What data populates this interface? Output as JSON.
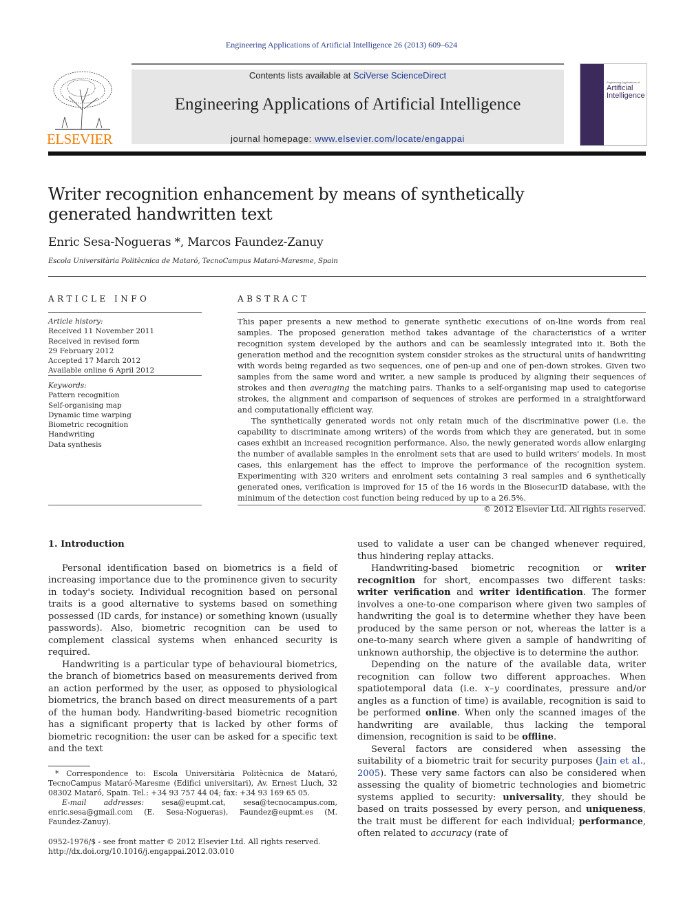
{
  "header": {
    "citation": "Engineering Applications of Artificial Intelligence 26 (2013) 609–624",
    "contents_prefix": "Contents lists available at ",
    "contents_link": "SciVerse ScienceDirect",
    "journal_title": "Engineering Applications of Artificial Intelligence",
    "homepage_prefix": "journal homepage: ",
    "homepage_link": "www.elsevier.com/locate/engappai",
    "publisher_logo": "ELSEVIER",
    "cover_title_line1": "Artificial",
    "cover_title_line2": "Intelligence",
    "cover_kicker": "Engineering Applications of"
  },
  "article": {
    "title": "Writer recognition enhancement by means of synthetically generated handwritten text",
    "authors": "Enric Sesa-Nogueras *, Marcos Faundez-Zanuy",
    "affiliation": "Escola Universitària Politècnica de Mataró, TecnoCampus Mataró-Maresme, Spain"
  },
  "article_info": {
    "heading": "ARTICLE INFO",
    "history_label": "Article history:",
    "history": [
      "Received 11 November 2011",
      "Received in revised form",
      "29 February 2012",
      "Accepted 17 March 2012",
      "Available online 6 April 2012"
    ],
    "keywords_label": "Keywords:",
    "keywords": [
      "Pattern recognition",
      "Self-organising map",
      "Dynamic time warping",
      "Biometric recognition",
      "Handwriting",
      "Data synthesis"
    ]
  },
  "abstract": {
    "heading": "ABSTRACT",
    "p1_a": "This paper presents a new method to generate synthetic executions of on-line words from real samples. The proposed generation method takes advantage of the characteristics of a writer recognition system developed by the authors and can be seamlessly integrated into it. Both the generation method and the recognition system consider strokes as the structural units of handwriting with words being regarded as two sequences, one of pen-up and one of pen-down strokes. Given two samples from the same word and writer, a new sample is produced by aligning their sequences of strokes and then ",
    "p1_em": "averaging",
    "p1_b": " the matching pairs. Thanks to a self-organising map used to categorise strokes, the alignment and comparison of sequences of strokes are performed in a straightforward and computationally efficient way.",
    "p2": "The synthetically generated words not only retain much of the discriminative power (i.e. the capability to discriminate among writers) of the words from which they are generated, but in some cases exhibit an increased recognition performance. Also, the newly generated words allow enlarging the number of available samples in the enrolment sets that are used to build writers' models. In most cases, this enlargement has the effect to improve the performance of the recognition system. Experimenting with 320 writers and enrolment sets containing 3 real samples and 6 synthetically generated ones, verification is improved for 15 of the 16 words in the BiosecurID database, with the minimum of the detection cost function being reduced by up to a 26.5%.",
    "copyright": "© 2012 Elsevier Ltd. All rights reserved."
  },
  "intro": {
    "heading": "1.  Introduction",
    "left_p1": "Personal identification based on biometrics is a field of increasing importance due to the prominence given to security in today's society. Individual recognition based on personal traits is a good alternative to systems based on something possessed (ID cards, for instance) or something known (usually passwords). Also, biometric recognition can be used to complement classical systems when enhanced security is required.",
    "left_p2": "Handwriting is a particular type of behavioural biometrics, the branch of biometrics based on measurements derived from an action performed by the user, as opposed to physiological biometrics, the branch based on direct measurements of a part of the human body. Handwriting-based biometric recognition has a significant property that is lacked by other forms of biometric recognition: the user can be asked for a specific text and the text",
    "right_p0": "used to validate a user can be changed whenever required, thus hindering replay attacks.",
    "right_p1_a": "Handwriting-based biometric recognition or ",
    "right_p1_b1": "writer recognition",
    "right_p1_c": " for short, encompasses two different tasks: ",
    "right_p1_b2": "writer verification",
    "right_p1_d": " and ",
    "right_p1_b3": "writer identification",
    "right_p1_e": ". The former involves a one-to-one comparison where given two samples of handwriting the goal is to determine whether they have been produced by the same person or not, whereas the latter is a one-to-many search where given a sample of handwriting of unknown authorship, the objective is to determine the author.",
    "right_p2_a": "Depending on the nature of the available data, writer recognition can follow two different approaches. When spatiotemporal data (i.e. ",
    "right_p2_em": "x–y",
    "right_p2_b": " coordinates, pressure and/or angles as a function of time) is available, recognition is said to be performed ",
    "right_p2_b1": "online",
    "right_p2_c": ". When only the scanned images of the handwriting are available, thus lacking the temporal dimension, recognition is said to be ",
    "right_p2_b2": "offline",
    "right_p2_d": ".",
    "right_p3_a": "Several factors are considered when assessing the suitability of a biometric trait for security purposes (",
    "right_p3_ref": "Jain et al., 2005",
    "right_p3_b": "). These very same factors can also be considered when assessing the quality of biometric technologies and biometric systems applied to security: ",
    "right_p3_b1": "universality",
    "right_p3_c": ", they should be based on traits possessed by every person, and ",
    "right_p3_b2": "uniqueness",
    "right_p3_d": ", the trait must be different for each individual; ",
    "right_p3_b3": "performance",
    "right_p3_e": ", often related to ",
    "right_p3_em": "accuracy",
    "right_p3_f": " (rate of"
  },
  "footnote": {
    "corr": "* Correspondence to: Escola Universitària Politècnica de Mataró, TecnoCampus Mataró-Maresme (Edifici universitari), Av. Ernest Lluch, 32 08302 Mataró, Spain. Tel.: +34 93 757 44 04; fax: +34 93 169 65 05.",
    "email_label": "E-mail addresses:",
    "emails": " sesa@eupmt.cat, sesa@tecnocampus.com, enric.sesa@gmail.com (E. Sesa-Nogueras), Faundez@eupmt.es (M. Faundez-Zanuy).",
    "issn": "0952-1976/$ - see front matter © 2012 Elsevier Ltd. All rights reserved.",
    "doi": "http://dx.doi.org/10.1016/j.engappai.2012.03.010"
  }
}
